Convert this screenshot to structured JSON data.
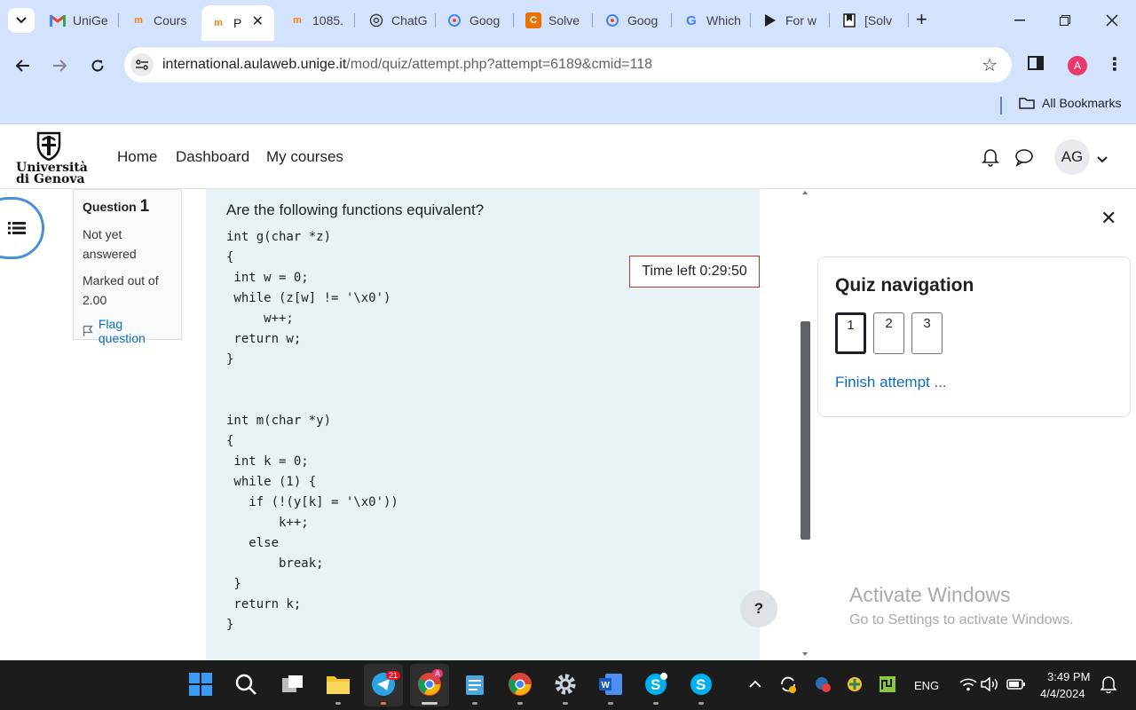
{
  "browser": {
    "tabs": [
      {
        "title": "UniGe",
        "favicon": "gmail-icon"
      },
      {
        "title": "Cours",
        "favicon": "moodle-icon"
      },
      {
        "title": "P",
        "favicon": "moodle-icon",
        "active": true
      },
      {
        "title": "1085.",
        "favicon": "moodle-icon"
      },
      {
        "title": "ChatG",
        "favicon": "chatgpt-icon"
      },
      {
        "title": "Goog",
        "favicon": "google-lens-icon"
      },
      {
        "title": "Solve",
        "favicon": "chegg-icon"
      },
      {
        "title": "Goog",
        "favicon": "google-lens-icon"
      },
      {
        "title": "Which",
        "favicon": "google-icon"
      },
      {
        "title": "For w",
        "favicon": "play-icon"
      },
      {
        "title": "[Solv",
        "favicon": "bookmark-icon"
      }
    ],
    "url_host": "international.aulaweb.unige.it",
    "url_path": "/mod/quiz/attempt.php?attempt=6189&cmid=118",
    "profile_initial": "A",
    "bookmarks_label": "All Bookmarks"
  },
  "header": {
    "logo_line1": "Università",
    "logo_line2": "di Genova",
    "nav": [
      "Home",
      "Dashboard",
      "My courses"
    ],
    "avatar_initials": "AG"
  },
  "question": {
    "label": "Question",
    "number": "1",
    "state": "Not yet answered",
    "marks": "Marked out of 2.00",
    "flag_label": "Flag question",
    "text": "Are the following functions equivalent?",
    "code_lines": [
      "int g(char *z)",
      "{",
      " int w = 0;",
      " while (z[w] != '\\x0')",
      "     w++;",
      " return w;",
      "}",
      "",
      "",
      "int m(char *y)",
      "{",
      " int k = 0;",
      " while (1) {",
      "   if (!(y[k] = '\\x0'))",
      "       k++;",
      "   else",
      "       break;",
      " }",
      " return k;",
      "}"
    ]
  },
  "timer": {
    "text": "Time left 0:29:50"
  },
  "quiz_nav": {
    "title": "Quiz navigation",
    "questions": [
      "1",
      "2",
      "3"
    ],
    "finish_label": "Finish attempt ..."
  },
  "help_label": "?",
  "watermark": {
    "line1": "Activate Windows",
    "line2": "Go to Settings to activate Windows."
  },
  "taskbar": {
    "language": "ENG",
    "time": "3:49 PM",
    "date": "4/4/2024",
    "telegram_badge": "21",
    "chrome_badge": "A"
  }
}
